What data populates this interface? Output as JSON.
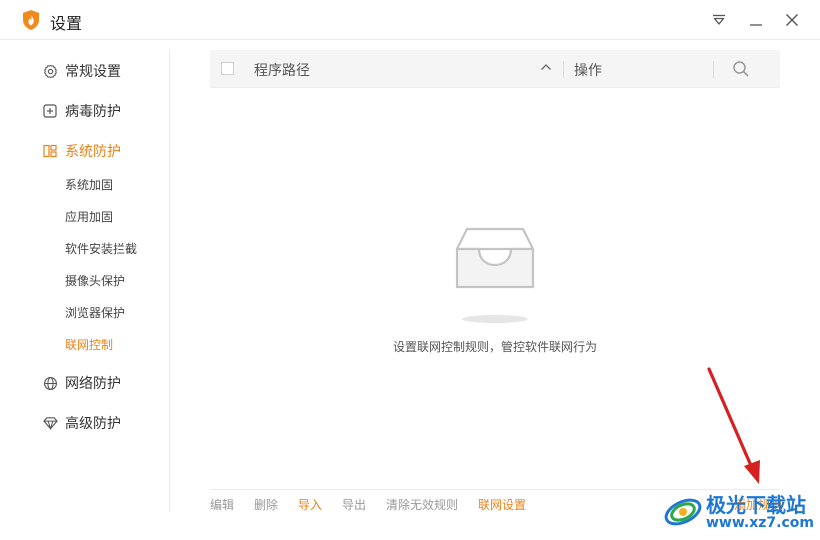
{
  "window": {
    "title": "设置"
  },
  "sidebar": {
    "items": [
      {
        "label": "常规设置",
        "icon": "gear-icon"
      },
      {
        "label": "病毒防护",
        "icon": "plus-square-icon"
      },
      {
        "label": "系统防护",
        "icon": "grid-icon",
        "active": true
      },
      {
        "label": "网络防护",
        "icon": "globe-icon"
      },
      {
        "label": "高级防护",
        "icon": "diamond-icon"
      }
    ],
    "subitems": [
      {
        "label": "系统加固"
      },
      {
        "label": "应用加固"
      },
      {
        "label": "软件安装拦截"
      },
      {
        "label": "摄像头保护"
      },
      {
        "label": "浏览器保护"
      },
      {
        "label": "联网控制",
        "active": true
      }
    ]
  },
  "table": {
    "col_path": "程序路径",
    "col_ops": "操作"
  },
  "empty": {
    "text": "设置联网控制规则，管控软件联网行为"
  },
  "footer": {
    "edit": "编辑",
    "delete": "删除",
    "import": "导入",
    "export": "导出",
    "clear": "清除无效规则",
    "settings": "联网设置",
    "add_rule": "添加规则"
  },
  "watermark": {
    "name": "极光下载站",
    "url": "www.xz7.com"
  },
  "colors": {
    "accent": "#e8831a",
    "arrow": "#d42020",
    "watermark": "#1e78d2"
  }
}
